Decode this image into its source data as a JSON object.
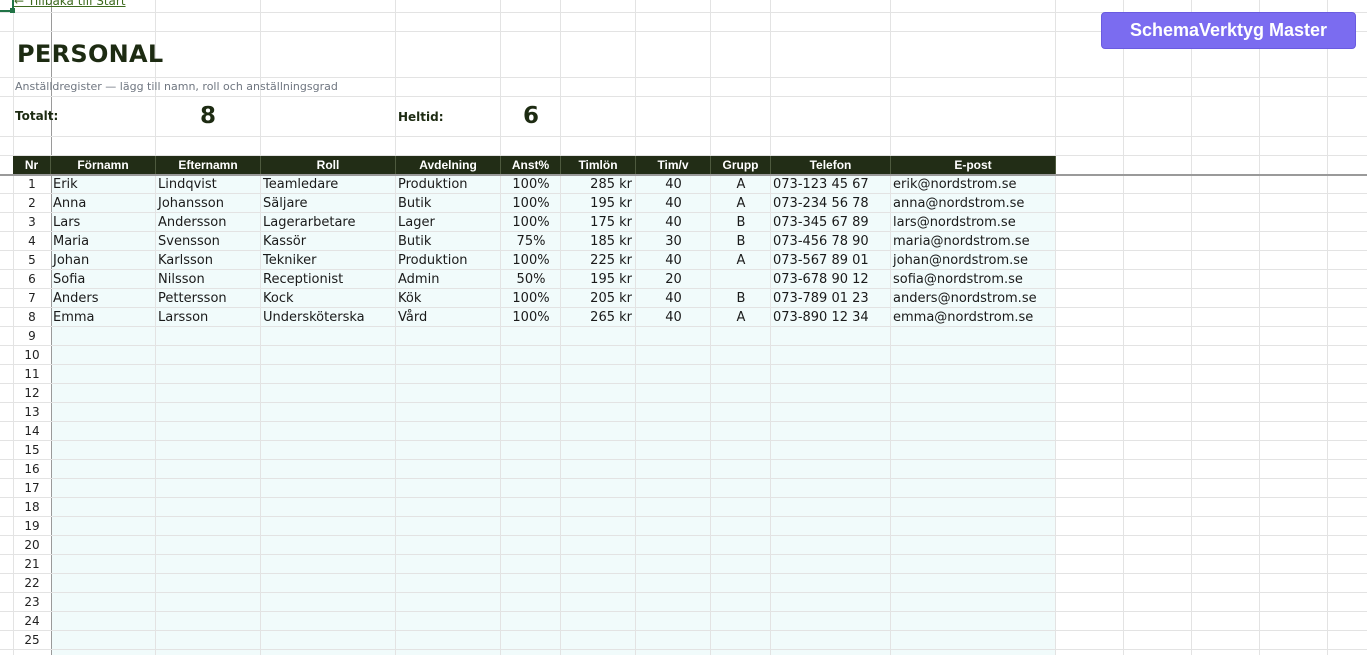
{
  "back_link": "← Tillbaka till Start",
  "title": "PERSONAL",
  "subtitle": "Anställdregister — lägg till namn, roll och anställningsgrad",
  "stats": {
    "total_label": "Totalt:",
    "total_value": "8",
    "fulltime_label": "Heltid:",
    "fulltime_value": "6"
  },
  "master_button": "SchemaVerktyg Master",
  "columns": [
    "Nr",
    "Förnamn",
    "Efternamn",
    "Roll",
    "Avdelning",
    "Anst%",
    "Timlön",
    "Tim/v",
    "Grupp",
    "Telefon",
    "E-post"
  ],
  "rows": [
    [
      "1",
      "Erik",
      "Lindqvist",
      "Teamledare",
      "Produktion",
      "100%",
      "285 kr",
      "40",
      "A",
      "073-123 45 67",
      "erik@nordstrom.se"
    ],
    [
      "2",
      "Anna",
      "Johansson",
      "Säljare",
      "Butik",
      "100%",
      "195 kr",
      "40",
      "A",
      "073-234 56 78",
      "anna@nordstrom.se"
    ],
    [
      "3",
      "Lars",
      "Andersson",
      "Lagerarbetare",
      "Lager",
      "100%",
      "175 kr",
      "40",
      "B",
      "073-345 67 89",
      "lars@nordstrom.se"
    ],
    [
      "4",
      "Maria",
      "Svensson",
      "Kassör",
      "Butik",
      "75%",
      "185 kr",
      "30",
      "B",
      "073-456 78 90",
      "maria@nordstrom.se"
    ],
    [
      "5",
      "Johan",
      "Karlsson",
      "Tekniker",
      "Produktion",
      "100%",
      "225 kr",
      "40",
      "A",
      "073-567 89 01",
      "johan@nordstrom.se"
    ],
    [
      "6",
      "Sofia",
      "Nilsson",
      "Receptionist",
      "Admin",
      "50%",
      "195 kr",
      "20",
      "",
      "073-678 90 12",
      "sofia@nordstrom.se"
    ],
    [
      "7",
      "Anders",
      "Pettersson",
      "Kock",
      "Kök",
      "100%",
      "205 kr",
      "40",
      "B",
      "073-789 01 23",
      "anders@nordstrom.se"
    ],
    [
      "8",
      "Emma",
      "Larsson",
      "Undersköterska",
      "Vård",
      "100%",
      "265 kr",
      "40",
      "A",
      "073-890 12 34",
      "emma@nordstrom.se"
    ],
    [
      "9",
      "",
      "",
      "",
      "",
      "",
      "",
      "",
      "",
      "",
      ""
    ],
    [
      "10",
      "",
      "",
      "",
      "",
      "",
      "",
      "",
      "",
      "",
      ""
    ],
    [
      "11",
      "",
      "",
      "",
      "",
      "",
      "",
      "",
      "",
      "",
      ""
    ],
    [
      "12",
      "",
      "",
      "",
      "",
      "",
      "",
      "",
      "",
      "",
      ""
    ],
    [
      "13",
      "",
      "",
      "",
      "",
      "",
      "",
      "",
      "",
      "",
      ""
    ],
    [
      "14",
      "",
      "",
      "",
      "",
      "",
      "",
      "",
      "",
      "",
      ""
    ],
    [
      "15",
      "",
      "",
      "",
      "",
      "",
      "",
      "",
      "",
      "",
      ""
    ],
    [
      "16",
      "",
      "",
      "",
      "",
      "",
      "",
      "",
      "",
      "",
      ""
    ],
    [
      "17",
      "",
      "",
      "",
      "",
      "",
      "",
      "",
      "",
      "",
      ""
    ],
    [
      "18",
      "",
      "",
      "",
      "",
      "",
      "",
      "",
      "",
      "",
      ""
    ],
    [
      "19",
      "",
      "",
      "",
      "",
      "",
      "",
      "",
      "",
      "",
      ""
    ],
    [
      "20",
      "",
      "",
      "",
      "",
      "",
      "",
      "",
      "",
      "",
      ""
    ],
    [
      "21",
      "",
      "",
      "",
      "",
      "",
      "",
      "",
      "",
      "",
      ""
    ],
    [
      "22",
      "",
      "",
      "",
      "",
      "",
      "",
      "",
      "",
      "",
      ""
    ],
    [
      "23",
      "",
      "",
      "",
      "",
      "",
      "",
      "",
      "",
      "",
      ""
    ],
    [
      "24",
      "",
      "",
      "",
      "",
      "",
      "",
      "",
      "",
      "",
      ""
    ],
    [
      "25",
      "",
      "",
      "",
      "",
      "",
      "",
      "",
      "",
      "",
      ""
    ]
  ],
  "colors": {
    "header_bg": "#222d16",
    "header_text": "#ffffff",
    "row_tint": "#f1fbfb",
    "button_bg": "#7b6cf0",
    "title_text": "#1d2b12",
    "link_text": "#3d6a1e"
  }
}
